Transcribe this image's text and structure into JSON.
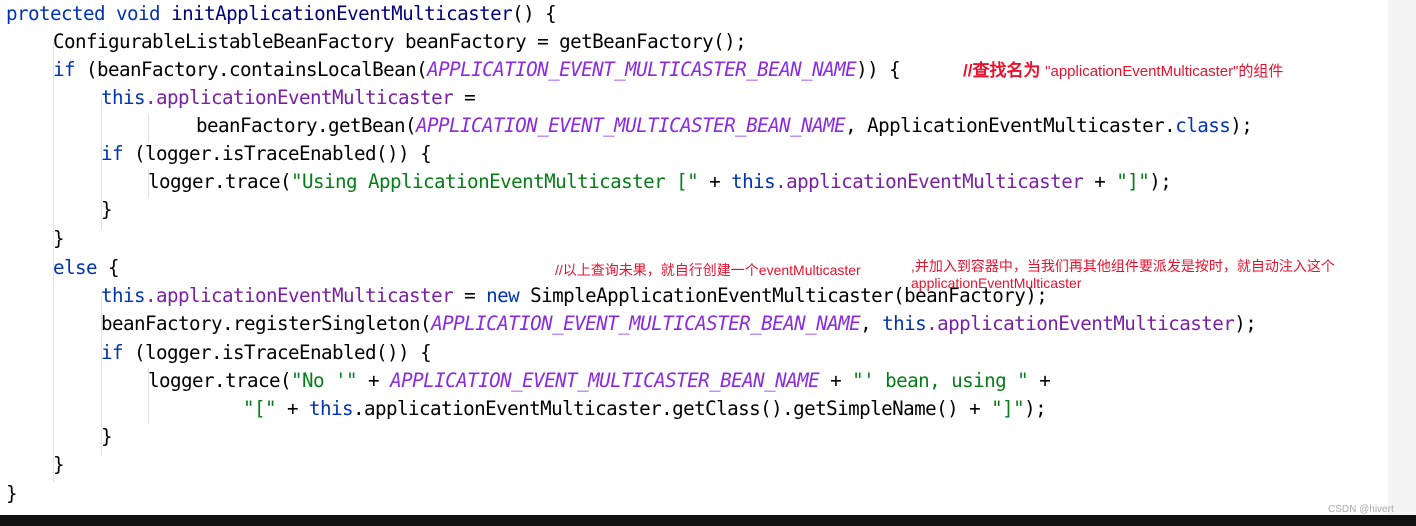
{
  "code": {
    "sig_protected": "protected",
    "sig_void": "void",
    "sig_name": "initApplicationEventMulticaster",
    "sig_rest": "() {",
    "l2": "ConfigurableListableBeanFactory beanFactory = getBeanFactory();",
    "kw_if": "if",
    "l3_open": " (beanFactory.containsLocalBean(",
    "const_name": "APPLICATION_EVENT_MULTICASTER_BEAN_NAME",
    "l3_close": ")) {",
    "kw_this": "this",
    "field_multicaster": ".applicationEventMulticaster",
    "assign": " =",
    "l5_open": "beanFactory.getBean(",
    "l5_mid": ", ApplicationEventMulticaster.",
    "kw_class": "class",
    "l5_close": ");",
    "if_trace_open": " (logger.isTraceEnabled()) {",
    "logger_trace_open": "logger.trace(",
    "str_using": "\"Using ApplicationEventMulticaster [\"",
    "plus": " + ",
    "str_close_bracket": "\"]\"",
    "close_paren_semi": ");",
    "close_brace": "}",
    "kw_else": "else",
    "open_brace": " {",
    "assign_eq": " = ",
    "kw_new": "new",
    "l11_rest": " SimpleApplicationEventMulticaster(beanFactory);",
    "l12_open": "beanFactory.registerSingleton(",
    "comma_space": ", ",
    "str_no": "\"No '\"",
    "str_bean_using": "\"' bean, using \"",
    "plus_end": " +",
    "str_open_bracket": "\"[\"",
    "l16_mid": ".applicationEventMulticaster.getClass().getSimpleName() + ",
    "semi_end": ");"
  },
  "annotations": {
    "note1_prefix": "//查找名为 ",
    "note1_suffix": "\"applicationEventMulticaster\"的组件",
    "note2": "//以上查询未果，就自行创建一个eventMulticaster",
    "note3_line1": ",并加入到容器中，当我们再其他组件要派发是按时，就自动注入这个",
    "note3_line2": "applicationEventMulticaster"
  },
  "watermark": "CSDN @hivert",
  "colors": {
    "keyword": "#0033b3",
    "method_name": "#000080",
    "field": "#7a1fa8",
    "constant": "#8a2be2",
    "string": "#067d17",
    "annotation": "#e8112d"
  }
}
